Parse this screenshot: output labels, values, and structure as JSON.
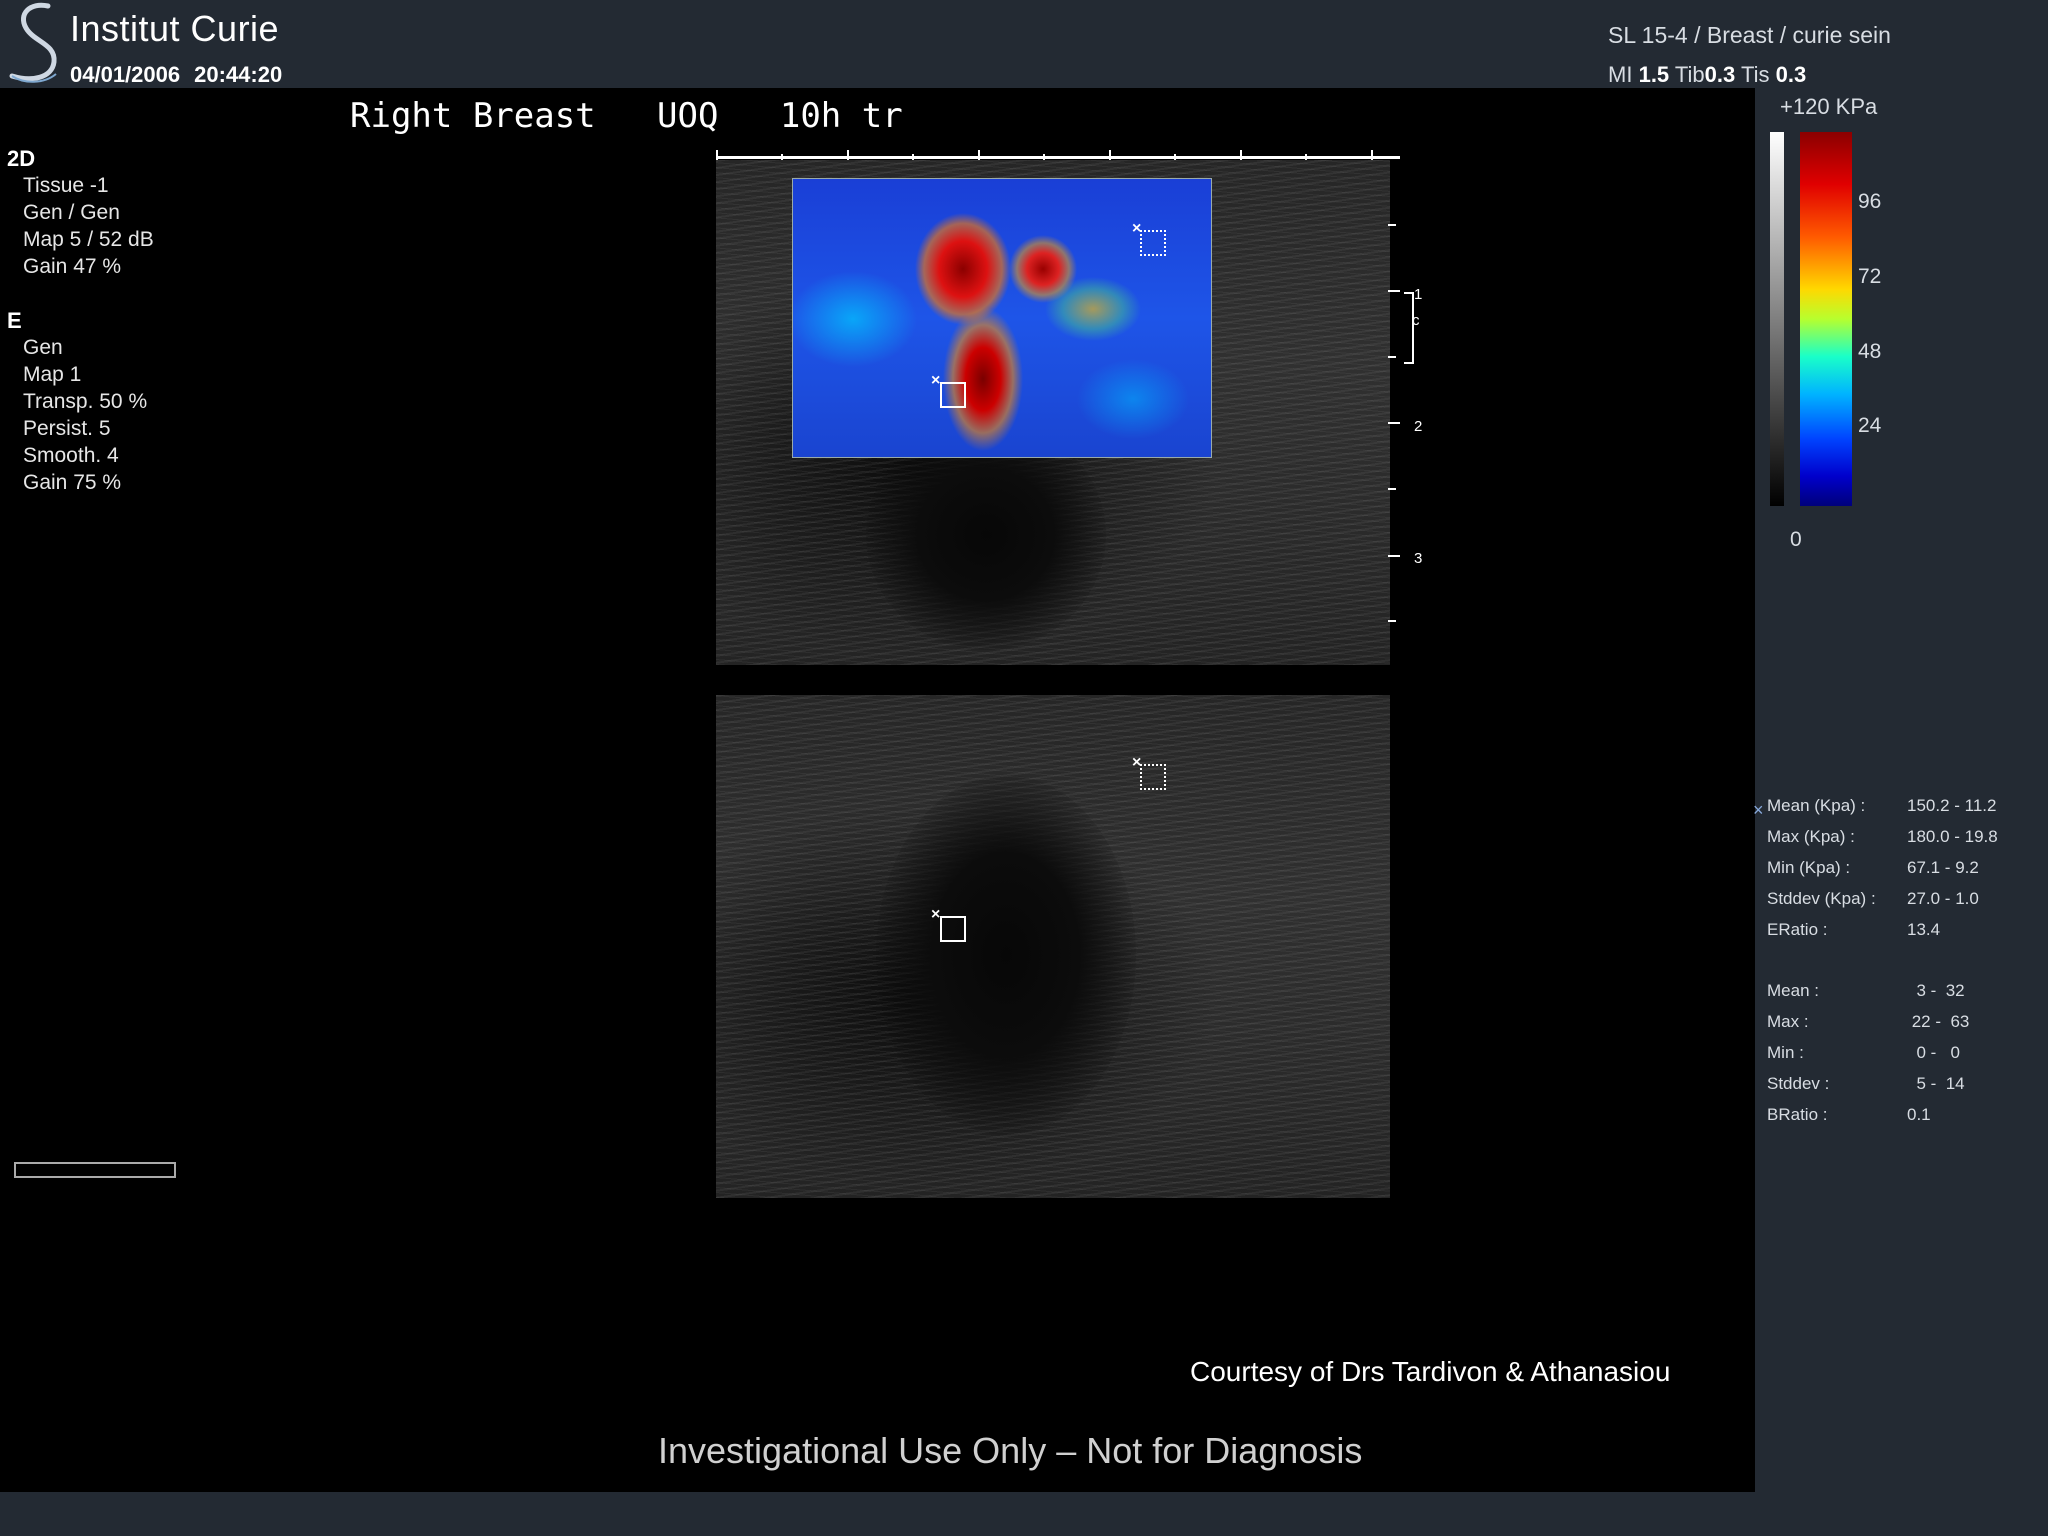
{
  "header": {
    "institution": "Institut Curie",
    "date": "04/01/2006",
    "time": "20:44:20",
    "probe_preset": "SL 15-4 / Breast / curie sein",
    "mi_label": "MI",
    "mi_value": "1.5",
    "tib_label": "Tib",
    "tib_value": "0.3",
    "tis_label": "Tis",
    "tis_value": "0.3"
  },
  "scan_title": "Right Breast   UOQ   10h tr",
  "params_2d": {
    "heading": "2D",
    "items": [
      "Tissue -1",
      "Gen / Gen",
      "Map 5 / 52 dB",
      "Gain 47 %"
    ]
  },
  "params_e": {
    "heading": "E",
    "items": [
      "Gen",
      "Map 1",
      "Transp. 50 %",
      "Persist. 5",
      "Smooth. 4",
      "Gain 75 %"
    ]
  },
  "depth_labels": [
    "1",
    "2",
    "3"
  ],
  "focus_label": "c",
  "colorbar": {
    "max_label": "+120 KPa",
    "ticks": [
      "96",
      "72",
      "48",
      "24"
    ],
    "min_label": "0",
    "gradient_colors": [
      "#8b0000",
      "#ff0000",
      "#ffd800",
      "#1affc8",
      "#0044ff",
      "#00007a"
    ]
  },
  "measurements_elasticity": [
    {
      "label": "Mean (Kpa) :",
      "value": "150.2 - 11.2"
    },
    {
      "label": "Max (Kpa) :",
      "value": "180.0 - 19.8"
    },
    {
      "label": "Min (Kpa) :",
      "value": "67.1 - 9.2"
    },
    {
      "label": "Stddev (Kpa) :",
      "value": "27.0 - 1.0"
    },
    {
      "label": "ERatio :",
      "value": "13.4"
    }
  ],
  "measurements_bmode": [
    {
      "label": "Mean :",
      "value": "  3 -  32"
    },
    {
      "label": "Max :",
      "value": " 22 -  63"
    },
    {
      "label": "Min :",
      "value": "  0 -   0"
    },
    {
      "label": "Stddev :",
      "value": "  5 -  14"
    },
    {
      "label": "BRatio :",
      "value": "0.1"
    }
  ],
  "marker_symbol": "×",
  "courtesy": "Courtesy of Drs Tardivon & Athanasiou",
  "disclaimer": "Investigational Use Only – Not for Diagnosis"
}
